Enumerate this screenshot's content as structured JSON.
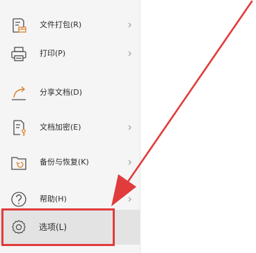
{
  "menu": {
    "items": [
      {
        "label": "文件打包(R)",
        "icon": "file-package-icon",
        "has_submenu": true
      },
      {
        "label": "打印(P)",
        "icon": "printer-icon",
        "has_submenu": true
      },
      {
        "label": "分享文档(D)",
        "icon": "share-icon",
        "has_submenu": false
      },
      {
        "label": "文档加密(E)",
        "icon": "document-lock-icon",
        "has_submenu": true
      },
      {
        "label": "备份与恢复(K)",
        "icon": "backup-restore-icon",
        "has_submenu": true
      },
      {
        "label": "帮助(H)",
        "icon": "help-icon",
        "has_submenu": true
      },
      {
        "label": "选项(L)",
        "icon": "gear-icon",
        "has_submenu": false
      }
    ],
    "active_item": "选项(L)"
  },
  "annotation": {
    "color": "#e13b3b",
    "highlights": "选项(L)"
  },
  "colors": {
    "menu_background": "#f5f5f5",
    "active_background": "#e3e3e3",
    "icon_stroke": "#4a4a4a",
    "text": "#2b2b2b"
  }
}
